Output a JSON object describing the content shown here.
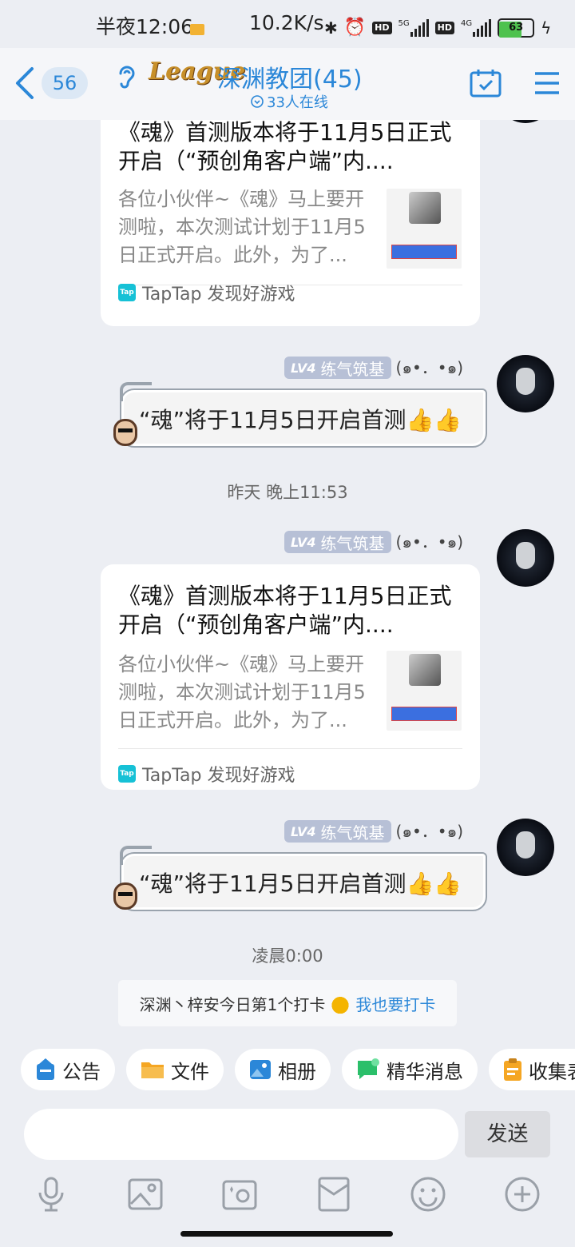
{
  "status": {
    "time": "半夜12:06",
    "speed": "10.2K/s",
    "hd1": "HD",
    "net1": "5G",
    "hd2": "HD",
    "net2": "4G",
    "battery": "63"
  },
  "header": {
    "unread": "56",
    "league": "League",
    "title": "深渊教团(45)",
    "online": "33人在线"
  },
  "messages": [
    {
      "card": {
        "title": "《魂》首测版本将于11月5日正式开启（“预创角客户端”内....",
        "desc": "各位小伙伴~《魂》马上要开测啦，本次测试计划于11月5日正式开启。此外，为了...",
        "source": "TapTap 发现好游戏",
        "tap": "Tap"
      }
    },
    {
      "level": "LV4",
      "badge": "练气筑基",
      "kaomoji": "(๑•．•๑)",
      "text": "“魂”将于11月5日开启首测👍👍"
    },
    {
      "level": "LV4",
      "badge": "练气筑基",
      "kaomoji": "(๑•．•๑)",
      "card": {
        "title": "《魂》首测版本将于11月5日正式开启（“预创角客户端”内....",
        "desc": "各位小伙伴~《魂》马上要开测啦，本次测试计划于11月5日正式开启。此外，为了...",
        "source": "TapTap 发现好游戏",
        "tap": "Tap"
      }
    },
    {
      "level": "LV4",
      "badge": "练气筑基",
      "kaomoji": "(๑•．•๑)",
      "text": "“魂”将于11月5日开启首测👍👍"
    }
  ],
  "timestamps": [
    "昨天 晚上11:53",
    "凌晨0:00"
  ],
  "checkin": {
    "text": "深渊丶梓安今日第1个打卡",
    "link": "我也要打卡"
  },
  "quick": [
    "公告",
    "文件",
    "相册",
    "精华消息",
    "收集表"
  ],
  "input": {
    "send": "发送"
  },
  "colors": {
    "accent": "#2b87d8",
    "bg": "#eceef3",
    "badge": "#b7c0d6"
  }
}
